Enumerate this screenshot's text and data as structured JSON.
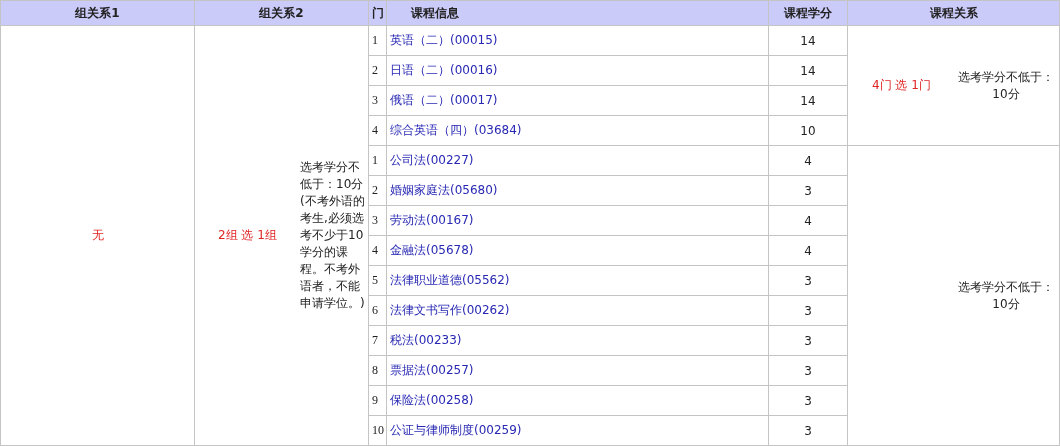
{
  "table": {
    "columns": [
      "组关系1",
      "组关系2",
      "门",
      "课程信息",
      "课程学分",
      "课程关系"
    ],
    "group_relation_1": "无",
    "group_relation_2": "2组 选 1组",
    "group_note": "选考学分不低于：10分\n(不考外语的考生,必须选考不少于10学分的课程。不考外语者，不能申请学位。)",
    "groups": [
      {
        "relation": "4门 选 1门",
        "note": "选考学分不低于：10分",
        "courses": [
          {
            "index": "1",
            "name": "英语（二）(00015)",
            "credits": "14"
          },
          {
            "index": "2",
            "name": "日语（二）(00016)",
            "credits": "14"
          },
          {
            "index": "3",
            "name": "俄语（二）(00017)",
            "credits": "14"
          },
          {
            "index": "4",
            "name": "综合英语（四）(03684)",
            "credits": "10"
          }
        ]
      },
      {
        "note": "选考学分不低于：10分",
        "courses": [
          {
            "index": "1",
            "name": "公司法(00227)",
            "credits": "4"
          },
          {
            "index": "2",
            "name": "婚姻家庭法(05680)",
            "credits": "3"
          },
          {
            "index": "3",
            "name": "劳动法(00167)",
            "credits": "4"
          },
          {
            "index": "4",
            "name": "金融法(05678)",
            "credits": "4"
          },
          {
            "index": "5",
            "name": "法律职业道德(05562)",
            "credits": "3"
          },
          {
            "index": "6",
            "name": "法律文书写作(00262)",
            "credits": "3"
          },
          {
            "index": "7",
            "name": "税法(00233)",
            "credits": "3"
          },
          {
            "index": "8",
            "name": "票据法(00257)",
            "credits": "3"
          },
          {
            "index": "9",
            "name": "保险法(00258)",
            "credits": "3"
          },
          {
            "index": "10",
            "name": "公证与律师制度(00259)",
            "credits": "3"
          }
        ]
      }
    ]
  }
}
